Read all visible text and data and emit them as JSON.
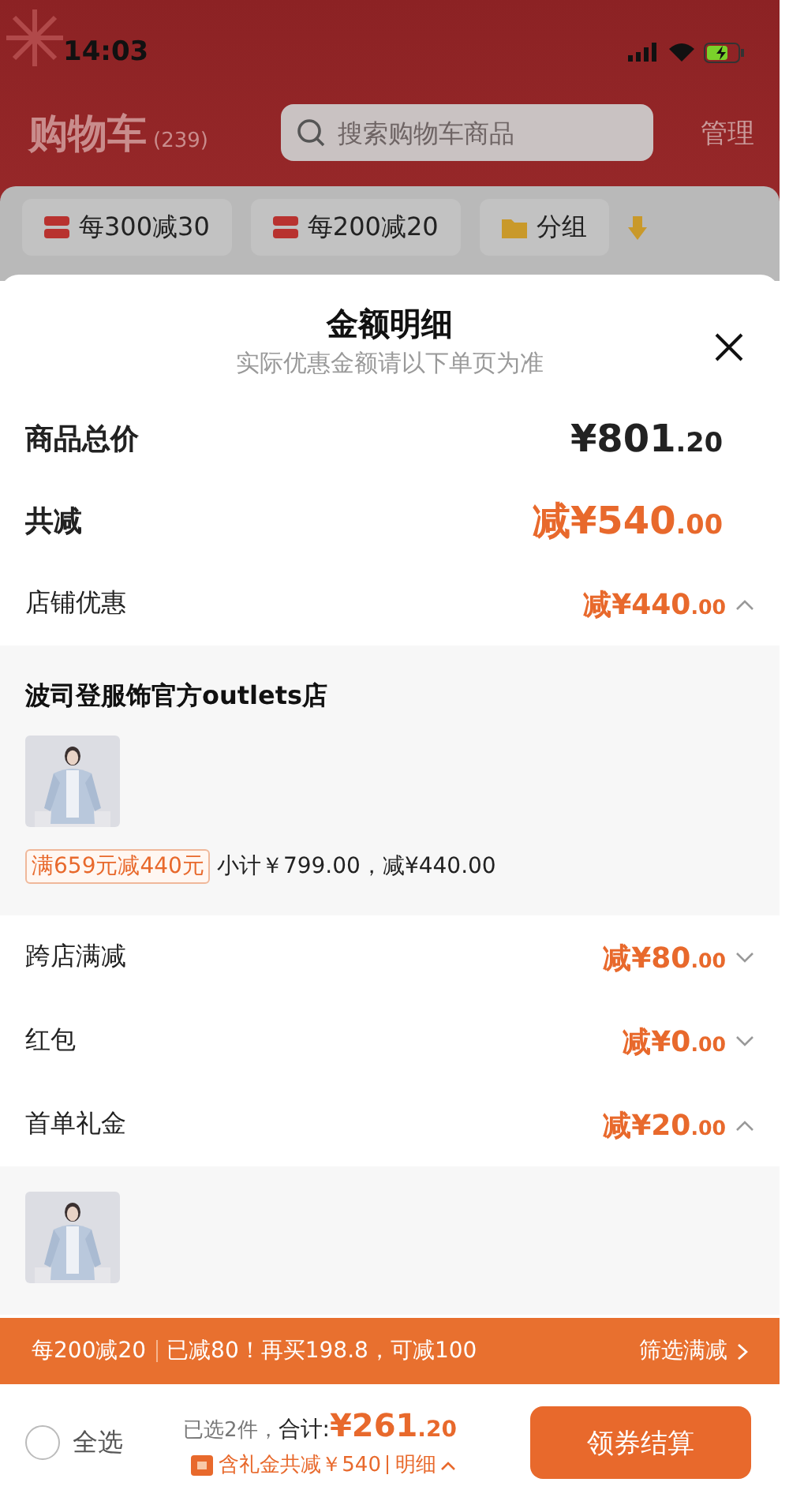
{
  "status_bar": {
    "time": "14:03"
  },
  "header": {
    "title": "购物车",
    "count": "(239)",
    "search": {
      "placeholder": "搜索购物车商品"
    },
    "manage": "管理"
  },
  "chips": [
    {
      "kind": "promo",
      "label": "每300减30"
    },
    {
      "kind": "promo",
      "label": "每200减20"
    },
    {
      "kind": "folder",
      "label": "分组"
    },
    {
      "kind": "more"
    }
  ],
  "sheet": {
    "title": "金额明细",
    "subtitle": "实际优惠金额请以下单页为准",
    "summary": [
      {
        "kind": "total",
        "label": "商品总价",
        "amount": "¥801.20"
      },
      {
        "kind": "discount",
        "label": "共减",
        "amount": "减¥540.00"
      }
    ],
    "sections": [
      {
        "label": "店铺优惠",
        "amount": "减¥440.00",
        "expanded": true,
        "detail": {
          "store": "波司登服饰官方outlets店",
          "tag": "满659元减440元",
          "subtotal": "小计￥799.00，减¥440.00"
        }
      },
      {
        "label": "跨店满减",
        "amount": "减¥80.00",
        "expanded": false
      },
      {
        "label": "红包",
        "amount": "减¥0.00",
        "expanded": false
      },
      {
        "label": "首单礼金",
        "amount": "减¥20.00",
        "expanded": true
      }
    ]
  },
  "banner": {
    "promo": "每200减20",
    "message": "已减80！再买198.8，可减100",
    "link": "筛选满减"
  },
  "footer": {
    "select_all": {
      "label": "全选",
      "checked": false
    },
    "count": "已选2件，",
    "total_label": "合计:",
    "total": "¥261.20",
    "note": "含礼金共减￥540",
    "detail_link": "明细",
    "checkout": "领券结算"
  }
}
